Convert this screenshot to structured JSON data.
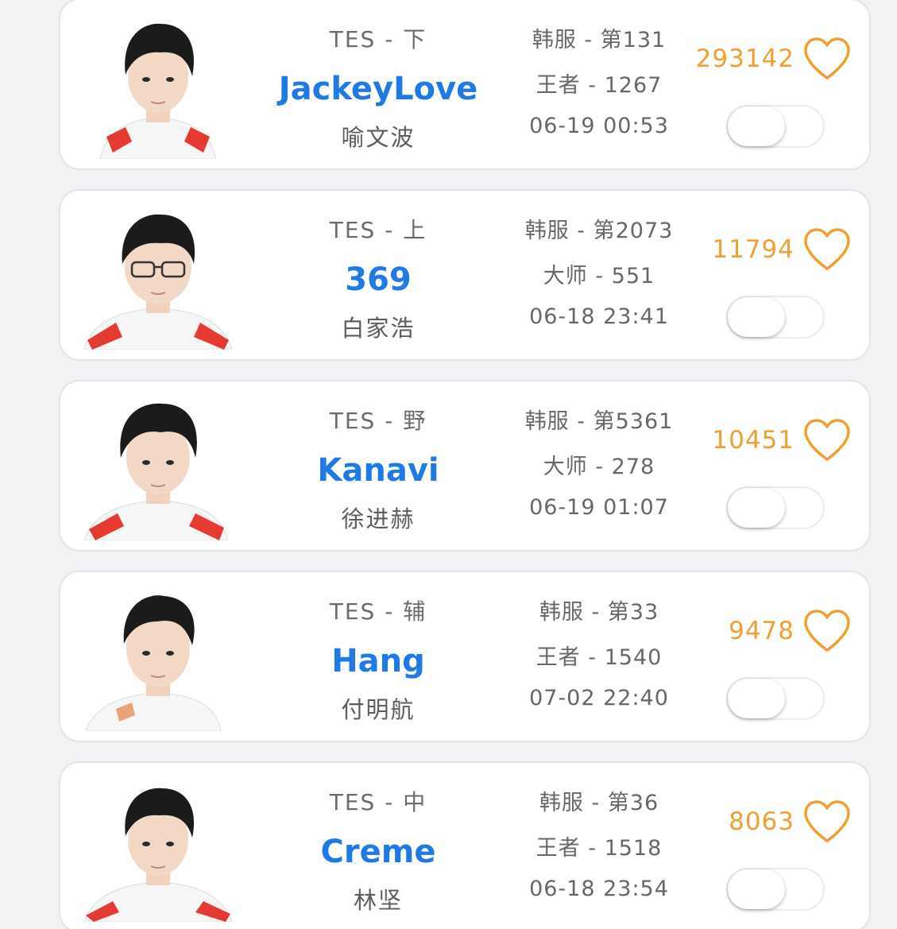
{
  "colors": {
    "accent_blue": "#1f7ae6",
    "like_orange": "#f0a030",
    "card_border": "#e4e4e8",
    "background": "#f2f2f4"
  },
  "icons": {
    "heart": "heart-outline-icon"
  },
  "players": [
    {
      "team_role": "TES - 下",
      "nickname": "JackeyLove",
      "real_name": "喻文波",
      "server_rank": "韩服 - 第131",
      "tier_points": "王者 - 1267",
      "updated": "06-19 00:53",
      "likes": "293142",
      "toggle_on": false
    },
    {
      "team_role": "TES - 上",
      "nickname": "369",
      "real_name": "白家浩",
      "server_rank": "韩服 - 第2073",
      "tier_points": "大师 - 551",
      "updated": "06-18 23:41",
      "likes": "11794",
      "toggle_on": false
    },
    {
      "team_role": "TES - 野",
      "nickname": "Kanavi",
      "real_name": "徐进赫",
      "server_rank": "韩服 - 第5361",
      "tier_points": "大师 - 278",
      "updated": "06-19 01:07",
      "likes": "10451",
      "toggle_on": false
    },
    {
      "team_role": "TES - 辅",
      "nickname": "Hang",
      "real_name": "付明航",
      "server_rank": "韩服 - 第33",
      "tier_points": "王者 - 1540",
      "updated": "07-02 22:40",
      "likes": "9478",
      "toggle_on": false
    },
    {
      "team_role": "TES - 中",
      "nickname": "Creme",
      "real_name": "林坚",
      "server_rank": "韩服 - 第36",
      "tier_points": "王者 - 1518",
      "updated": "06-18 23:54",
      "likes": "8063",
      "toggle_on": false
    }
  ]
}
